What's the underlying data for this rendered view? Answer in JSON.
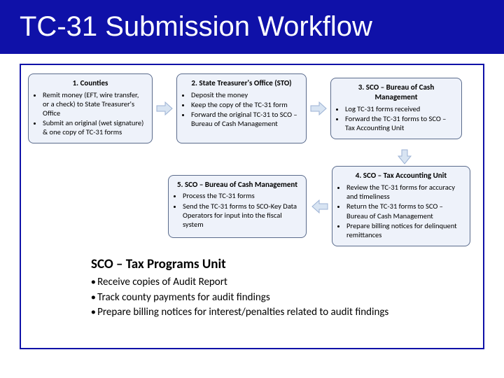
{
  "page_title": "TC-31 Submission Workflow",
  "steps": [
    {
      "title": "1. Counties",
      "items": [
        "Remit money (EFT, wire transfer, or a check) to State Treasurer's Office",
        "Submit an original (wet signature) & one copy of TC-31 forms"
      ]
    },
    {
      "title": "2. State Treasurer's Office (STO)",
      "items": [
        "Deposit the money",
        "Keep the copy of the TC-31 form",
        "Forward the original TC-31 to SCO – Bureau of Cash Management"
      ]
    },
    {
      "title": "3. SCO – Bureau of Cash Management",
      "items": [
        "Log TC-31 forms received",
        "Forward the TC-31 forms to SCO – Tax Accounting Unit"
      ]
    },
    {
      "title": "4. SCO – Tax Accounting Unit",
      "items": [
        "Review the TC-31 forms for accuracy and timeliness",
        "Return the TC-31 forms to SCO – Bureau of Cash Management",
        "Prepare billing notices for delinquent remittances"
      ]
    },
    {
      "title": "5. SCO – Bureau of Cash Management",
      "items": [
        "Process the TC-31 forms",
        "Send the TC-31 forms to SCO-Key Data Operators for input into the fiscal system"
      ]
    }
  ],
  "footer": {
    "title": "SCO – Tax Programs Unit",
    "items": [
      "Receive copies of Audit Report",
      "Track county payments for audit findings",
      "Prepare billing notices for interest/penalties related to audit findings"
    ]
  }
}
